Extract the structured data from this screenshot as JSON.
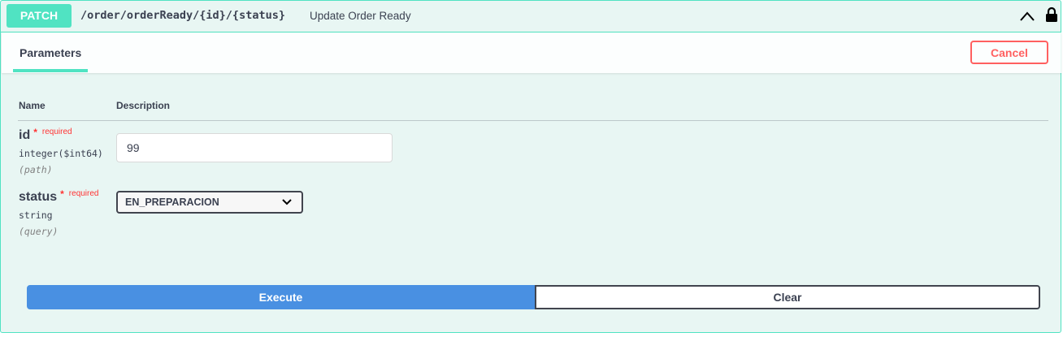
{
  "summary": {
    "method": "PATCH",
    "path": "/order/orderReady/{id}/{status}",
    "description": "Update Order Ready",
    "collapse_icon": "chevron-up-icon",
    "lock_icon": "lock-icon"
  },
  "tabs": {
    "parameters_label": "Parameters",
    "cancel_label": "Cancel"
  },
  "table": {
    "col_name": "Name",
    "col_description": "Description"
  },
  "params": [
    {
      "name": "id",
      "required_star": "*",
      "required_label": "required",
      "type": "integer($int64)",
      "in": "(path)",
      "value": "99"
    },
    {
      "name": "status",
      "required_star": "*",
      "required_label": "required",
      "type": "string",
      "in": "(query)",
      "value": "EN_PREPARACION"
    }
  ],
  "actions": {
    "execute_label": "Execute",
    "clear_label": "Clear"
  },
  "colors": {
    "accent": "#50e3c2",
    "background": "#e8f6f3",
    "danger": "#ff6060",
    "execute": "#4990e2",
    "text": "#3b4151"
  }
}
